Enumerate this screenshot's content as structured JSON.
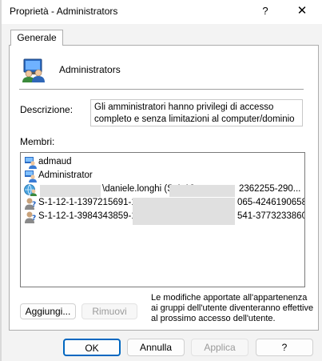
{
  "window": {
    "title": "Proprietà - Administrators",
    "help_glyph": "?",
    "close_glyph": "✕"
  },
  "tabs": [
    {
      "label": "Generale"
    }
  ],
  "group": {
    "icon": "group-users-icon",
    "name": "Administrators"
  },
  "description": {
    "label": "Descrizione:",
    "value": "Gli amministratori hanno privilegi di accesso completo e senza limitazioni al computer/dominio"
  },
  "members": {
    "label": "Membri:",
    "items": [
      {
        "icon": "user-icon",
        "text": "admaud"
      },
      {
        "icon": "user-icon",
        "text": "Administrator"
      },
      {
        "icon": "domain-user-icon",
        "text": "\\daniele.longhi (S-1-12-",
        "text_tail": "2362255-290..."
      },
      {
        "icon": "unknown-user-icon",
        "text": "S-1-12-1-1397215691-12",
        "text_tail": "065-4246190658"
      },
      {
        "icon": "unknown-user-icon",
        "text": "S-1-12-1-3984343859-11",
        "text_tail": "541-3773233860"
      }
    ]
  },
  "actions": {
    "add_label": "Aggiungi...",
    "remove_label": "Rimuovi",
    "note": "Le modifiche apportate all'appartenenza ai gruppi dell'utente diventeranno effettive al prossimo accesso dell'utente."
  },
  "footer": {
    "ok_label": "OK",
    "cancel_label": "Annulla",
    "apply_label": "Applica",
    "help_label": "?"
  },
  "colors": {
    "accent": "#0067c0",
    "window_bg": "#f3f3f3",
    "redaction": "#e0e0e0"
  }
}
